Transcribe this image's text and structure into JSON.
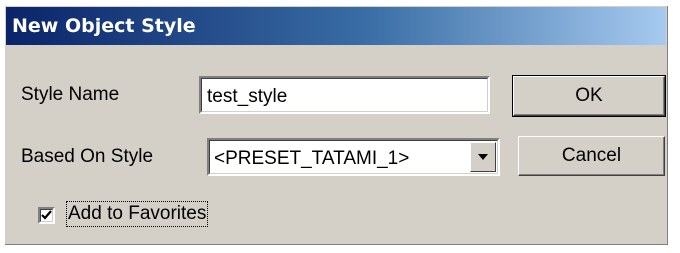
{
  "dialog": {
    "title": "New Object Style",
    "style_name_label": "Style Name",
    "style_name_value": "test_style",
    "based_on_label": "Based On Style",
    "based_on_value": "<PRESET_TATAMI_1>",
    "ok_label": "OK",
    "cancel_label": "Cancel",
    "favorites_label": "Add to Favorites",
    "favorites_checked": true
  },
  "colors": {
    "title_gradient_start": "#0a246a",
    "title_gradient_end": "#a6caf0",
    "dialog_bg": "#d4d0c8"
  },
  "icons": {
    "dropdown": "chevron-down-icon",
    "checkbox": "checkmark-icon"
  }
}
